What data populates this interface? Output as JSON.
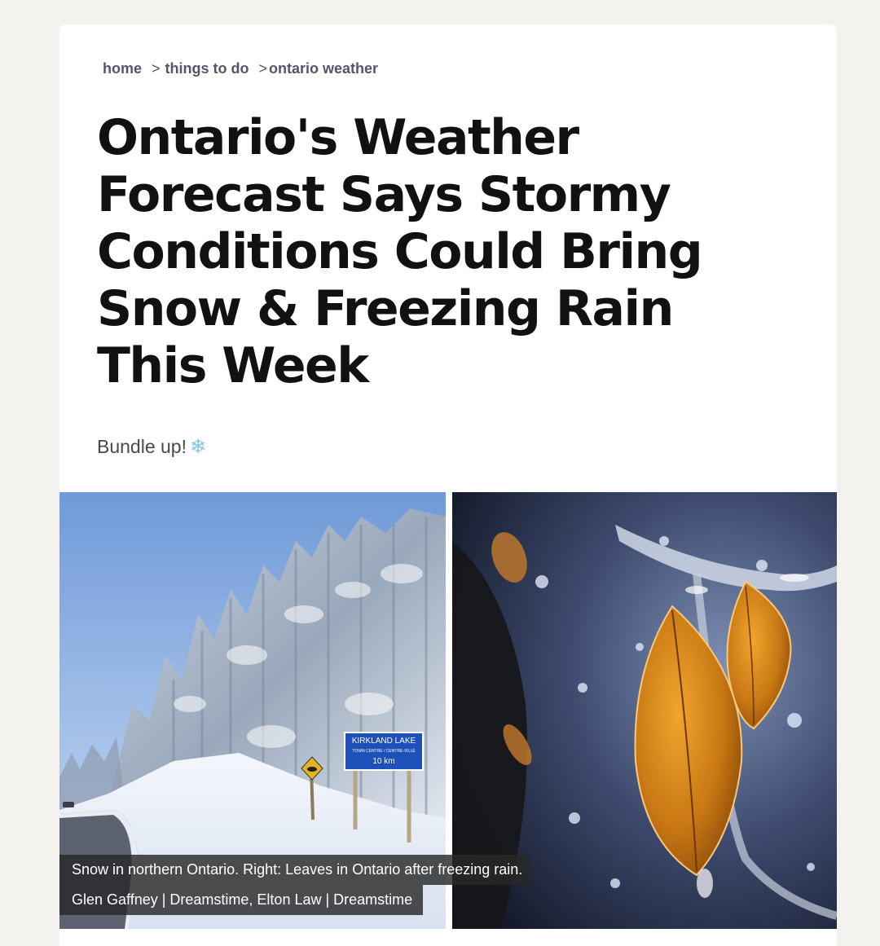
{
  "breadcrumb": {
    "home": "home",
    "sep1": ">",
    "things_to_do": "things to do",
    "sep2": ">",
    "current": "ontario weather"
  },
  "article": {
    "title": "Ontario's Weather Forecast Says Stormy Conditions Could Bring Snow & Freezing Rain This Week",
    "subtitle": "Bundle up!",
    "subtitle_emoji": "❄"
  },
  "images": {
    "left_sign": {
      "line1": "KIRKLAND LAKE",
      "line2": "TOWN CENTRE / CENTRE-VILLE",
      "line3": "10 km"
    },
    "caption": "Snow in northern Ontario. Right: Leaves in Ontario after freezing rain.",
    "credit": "Glen Gaffney | Dreamstime, Elton Law | Dreamstime"
  },
  "colors": {
    "background": "#f3f2ef",
    "card": "#ffffff",
    "breadcrumb": "#55556a",
    "headline": "#111111",
    "sign_blue": "#1f4fb8",
    "leaf_orange": "#d98a1c"
  }
}
